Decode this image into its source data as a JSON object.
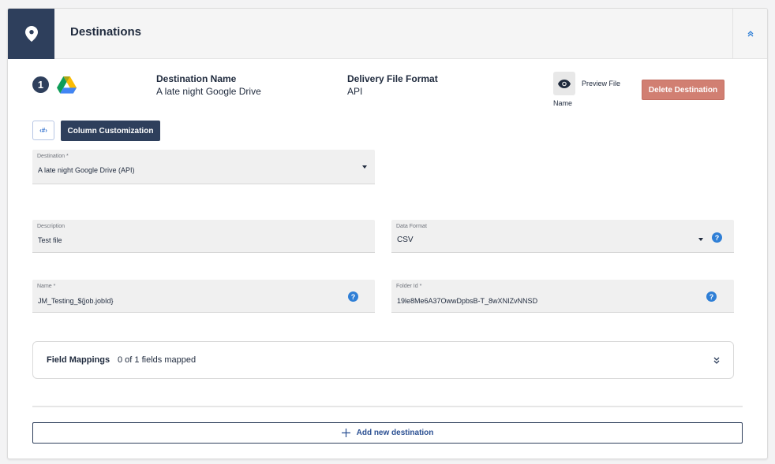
{
  "header": {
    "title": "Destinations",
    "icon": "location-pin-icon",
    "collapse_icon": "chevron-up-double-icon",
    "accent_color": "#2e3f5c"
  },
  "destination": {
    "index": "1",
    "icon": "google-drive-icon",
    "name_label": "Destination Name",
    "name_value": "A late night Google Drive",
    "format_label": "Delivery File Format",
    "format_value": "API",
    "preview_label": "Preview File",
    "preview_sub": "Name",
    "delete_label": "Delete Destination",
    "delete_color": "#d17f72"
  },
  "toolbar": {
    "code_icon_label": "‹#›",
    "column_customization": "Column Customization"
  },
  "fields": {
    "destination": {
      "label": "Destination *",
      "value": "A late night Google Drive (API)"
    },
    "description": {
      "label": "Description",
      "value": "Test file"
    },
    "data_format": {
      "label": "Data Format",
      "value": "CSV"
    },
    "name": {
      "label": "Name *",
      "value": "JM_Testing_${job.jobId}"
    },
    "folder_id": {
      "label": "Folder Id *",
      "value": "19le8Me6A37OwwDpbsB-T_8wXNIZvNNSD"
    }
  },
  "field_mappings": {
    "title": "Field Mappings",
    "count": "0 of 1 fields mapped"
  },
  "add_destination": {
    "label": "Add new destination",
    "icon": "plus-icon"
  }
}
